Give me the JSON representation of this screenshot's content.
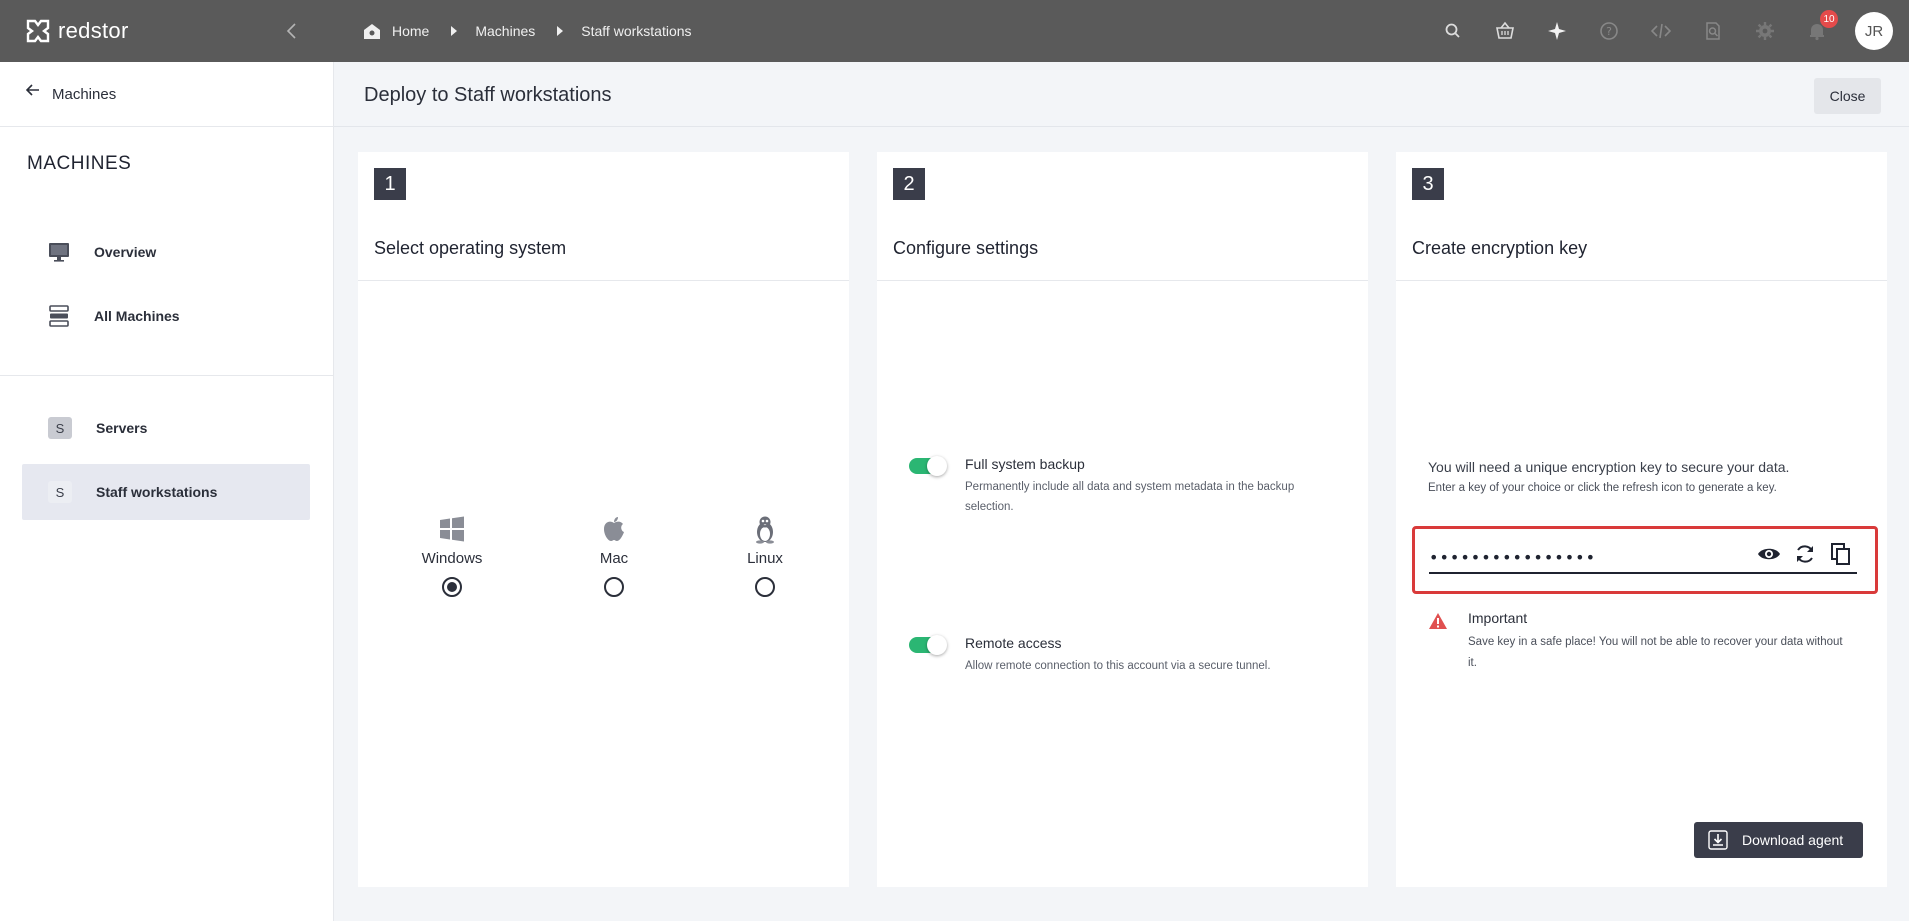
{
  "app": {
    "brand": "redstor"
  },
  "breadcrumb": {
    "home": "Home",
    "machines": "Machines",
    "current": "Staff workstations"
  },
  "topbar": {
    "notification_count": "10",
    "user_initials": "JR"
  },
  "sidebar": {
    "back_label": "Machines",
    "section_title": "MACHINES",
    "items": [
      {
        "label": "Overview",
        "icon": "monitor-icon"
      },
      {
        "label": "All Machines",
        "icon": "server-stack-icon"
      }
    ],
    "groups": [
      {
        "letter": "S",
        "label": "Servers"
      },
      {
        "letter": "S",
        "label": "Staff workstations"
      }
    ]
  },
  "main": {
    "title": "Deploy to Staff workstations",
    "close_label": "Close"
  },
  "steps": [
    {
      "number": "1",
      "title": "Select operating system"
    },
    {
      "number": "2",
      "title": "Configure settings"
    },
    {
      "number": "3",
      "title": "Create encryption key"
    }
  ],
  "os_options": [
    {
      "label": "Windows",
      "selected": true
    },
    {
      "label": "Mac",
      "selected": false
    },
    {
      "label": "Linux",
      "selected": false
    }
  ],
  "settings": [
    {
      "name": "Full system backup",
      "description": "Permanently include all data and system metadata in the backup selection.",
      "enabled": true
    },
    {
      "name": "Remote access",
      "description": "Allow remote connection to this account via a secure tunnel.",
      "enabled": true
    }
  ],
  "encryption": {
    "intro": "You will need a unique encryption key to secure your data.",
    "hint": "Enter a key of your choice or click the refresh icon to generate a key.",
    "masked_value": "••••••••••••••••",
    "warning_title": "Important",
    "warning_text": "Save key in a safe place! You will not be able to recover your data without it.",
    "download_label": "Download agent"
  },
  "colors": {
    "topbar": "#5a5a5a",
    "toggle_on": "#2bb673",
    "highlight": "#d93a3a",
    "dark_button": "#3a3d4a"
  }
}
